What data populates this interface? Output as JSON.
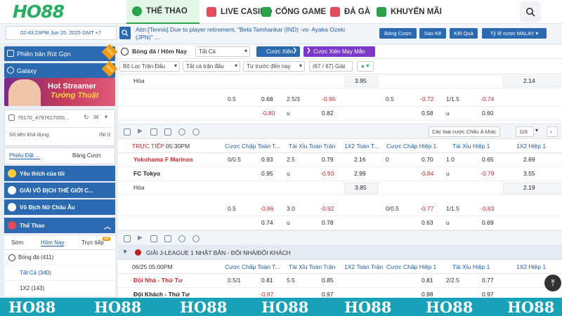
{
  "nav": {
    "logo": "HO88",
    "items": [
      {
        "label": "THỂ THAO",
        "icon": "soccer-icon",
        "color": "#2ca24a"
      },
      {
        "label": "LIVE CASINO",
        "icon": "casino-icon",
        "color": "#e34b5a"
      },
      {
        "label": "CỔNG GAME",
        "icon": "game-icon",
        "color": "#2ca24a"
      },
      {
        "label": "ĐÁ GÀ",
        "icon": "rooster-icon",
        "color": "#e34b5a"
      },
      {
        "label": "KHUYẾN MÃI",
        "icon": "gift-icon",
        "color": "#2ca24a"
      }
    ]
  },
  "subbar": {
    "clock": "02:43:23PM Jun 25, 2025 GMT +7",
    "ticker_line1": "Attn:[Tennis] Due to player retirement, \"Bela Tamhankar (IND) -vs- Ayaka Ozeki",
    "ticker_line2": "(JPN)\" ...",
    "buttons": [
      "Bảng Cược",
      "Sao Kê",
      "Kết Quả",
      "Tỷ lệ cược MALAY ▾"
    ]
  },
  "sidebar": {
    "btn_mobile": "Phiên bản Rút Gọn",
    "btn_galaxy": "Galaxy",
    "badge_new": "NEW",
    "banner_line1": "Hot Streamer",
    "banner_line2": "Tưởng Thuật",
    "account_id": "76170_4797617000...",
    "balance_label": "Số tiền khả dụng",
    "balance_value": "INI 0",
    "tab_a": "Phiếu Đặt ...",
    "tab_b": "Bảng Cược",
    "sections": [
      "Yêu thích của tôi",
      "GIẢI VÔ ĐỊCH THẾ GIỚI C...",
      "Vô Địch Nữ Châu Âu",
      "Thể Thao"
    ],
    "sport_tabs": [
      "Sớm",
      "Hôm Nay",
      "Trực tiếp"
    ],
    "live_count": "98",
    "sport_items": [
      {
        "label": "Bóng đá (411)"
      },
      {
        "label": "Tất Cả (340)"
      },
      {
        "label": "1X2 (143)"
      }
    ]
  },
  "main": {
    "breadcrumb": "Bóng đá / Hôm Nay",
    "filter_all": "Tất Cả",
    "btn_parlay": "Cược Xiên",
    "btn_lucky": "Cược Xiên May Mắn",
    "filter_match": "Bộ Lọc Trận Đấu",
    "filter_all_matches": "Tất cả trận đấu",
    "filter_sort": "Từ trước đến nay",
    "filter_count": "(67 / 67) Giải",
    "tool_odds_type": "Các loại cược Châu Á khác",
    "tool_num": "116"
  },
  "block1": {
    "draw_label": "Hòa",
    "draw_1x2_ft": "3.95",
    "draw_1x2_h1": "2.14",
    "row1": {
      "hdp": "0.5",
      "hdp_v": "0.68",
      "ou": "2.5/3",
      "ou_v": "-0.96",
      "h1_hdp": "0.5",
      "h1_hdp_v": "-0.72",
      "h1_ou": "1/1.5",
      "h1_ou_v": "-0.74"
    },
    "row2": {
      "hdp_v": "-0.80",
      "ou": "u",
      "ou_v": "0.82",
      "h1_hdp_v": "0.58",
      "h1_ou": "u",
      "h1_ou_v": "0.60"
    }
  },
  "live": {
    "status": "TRỰC TIẾP",
    "time": "05:30PM",
    "headers": [
      "Cược Chấp Toàn T...",
      "Tài Xỉu Toàn Trận",
      "1X2 Toàn T...",
      "Cược Chấp Hiệp 1",
      "Tài Xỉu Hiệp 1",
      "1X2 Hiệp 1"
    ],
    "home": "Yokohama F Marinos",
    "away": "FC Tokyo",
    "draw": "Hòa",
    "r1": {
      "hdp": "0/0.5",
      "hdp_v": "0.93",
      "ou": "2.5",
      "ou_v": "0.79",
      "x12": "2.16",
      "h1_hdp": "0",
      "h1_hdp_v": "0.70",
      "h1_ou": "1.0",
      "h1_ou_v": "0.65",
      "h1_x12": "2.69"
    },
    "r2": {
      "hdp_v": "0.95",
      "ou": "u",
      "ou_v": "-0.93",
      "x12": "2.99",
      "h1_hdp_v": "-0.84",
      "h1_ou": "u",
      "h1_ou_v": "-0.79",
      "h1_x12": "3.55"
    },
    "r3": {
      "x12": "3.85",
      "h1_x12": "2.19"
    },
    "r4": {
      "hdp": "0.5",
      "hdp_v": "-0.86",
      "ou": "3.0",
      "ou_v": "-0.92",
      "h1_hdp": "0/0.5",
      "h1_hdp_v": "-0.77",
      "h1_ou": "1/1.5",
      "h1_ou_v": "-0.83"
    },
    "r5": {
      "hdp_v": "0.74",
      "ou": "u",
      "ou_v": "0.78",
      "h1_hdp_v": "0.63",
      "h1_ou": "u",
      "h1_ou_v": "0.69"
    }
  },
  "league2": {
    "name": "GIẢI J-LEAGUE 1 NHẬT BẢN - ĐỘI NHÀ/ĐỘI KHÁCH",
    "date": "06/25 05:00PM",
    "headers": [
      "Cược Chấp Toàn T...",
      "Tài Xỉu Toàn Trận",
      "1X2 Toàn Trận",
      "Cược Chấp Hiệp 1",
      "Tài Xỉu Hiệp 1",
      "1X2 Hiệp 1"
    ],
    "home": "Đội Nhà - Thứ Tư",
    "away": "Đội Khách - Thứ Tư",
    "r1": {
      "hdp": "0.5/1",
      "hdp_v": "0.81",
      "ou": "5.5",
      "ou_v": "0.85",
      "h1_hdp_v": "0.81",
      "h1_ou": "2/2.5",
      "h1_ou_v": "0.77"
    },
    "r2": {
      "hdp_v": "-0.97",
      "ou_v": "0.97",
      "h1_hdp_v": "0.98",
      "h1_ou_v": "0.97"
    }
  },
  "footer_text": "HO88"
}
